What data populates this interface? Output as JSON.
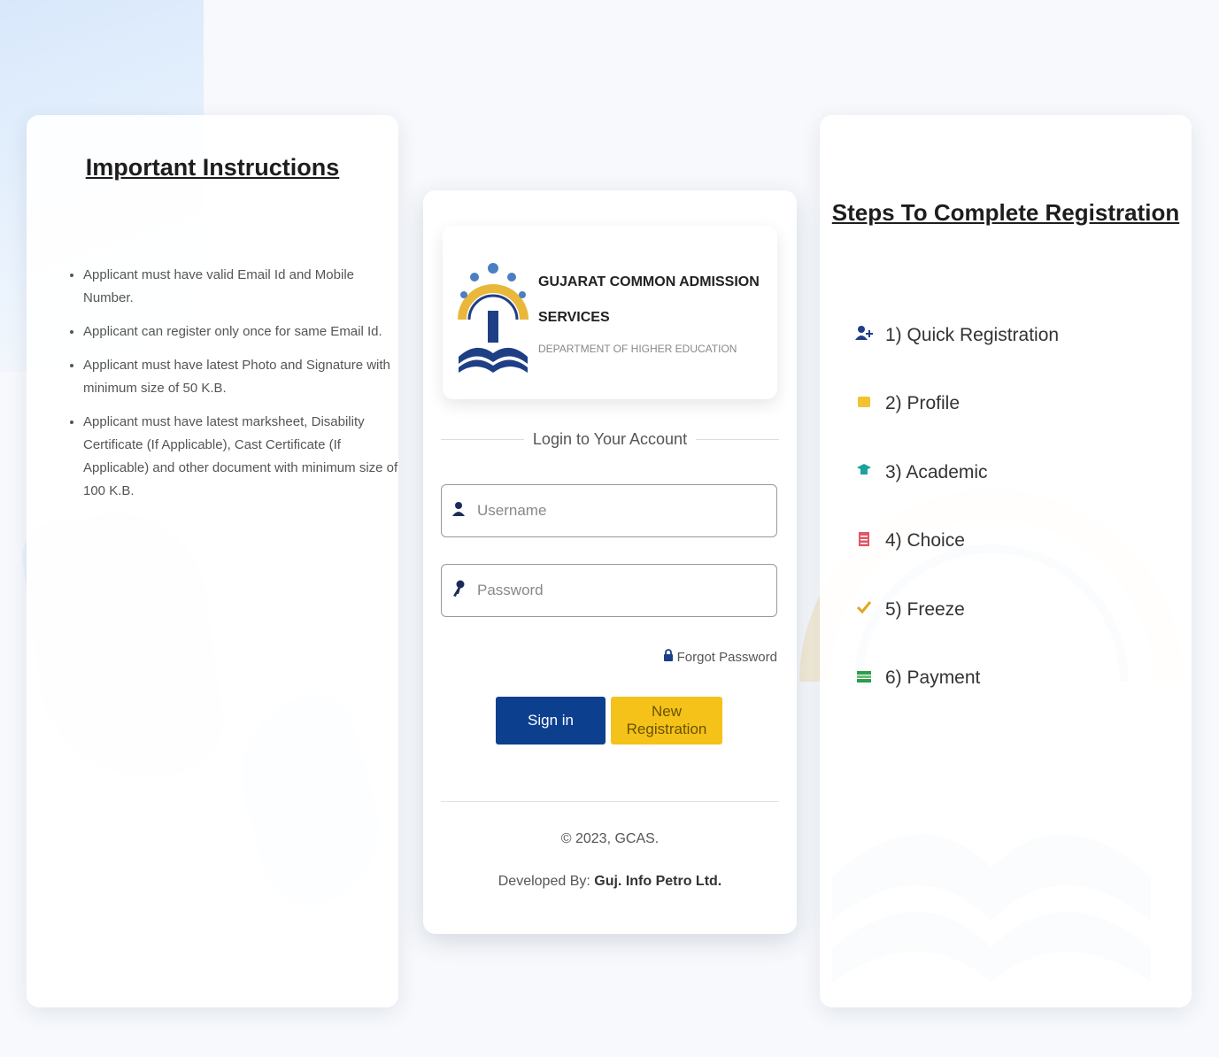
{
  "instructions": {
    "title": "Important Instructions",
    "items": [
      "Applicant must have valid Email Id and Mobile Number.",
      "Applicant can register only once for same Email Id.",
      "Applicant must have latest Photo and Signature with minimum size of 50 K.B.",
      "Applicant must have latest marksheet, Disability Certificate (If Applicable), Cast Certificate (If Applicable) and other document with minimum size of 100 K.B."
    ]
  },
  "brand": {
    "name": "GUJARAT COMMON ADMISSION SERVICES",
    "department": "DEPARTMENT OF HIGHER EDUCATION"
  },
  "login": {
    "heading": "Login to Your Account",
    "username_placeholder": "Username",
    "password_placeholder": "Password",
    "forgot_label": "Forgot Password",
    "signin_label": "Sign in",
    "register_label": "New Registration",
    "copyright": "© 2023, GCAS.",
    "developed_prefix": "Developed By: ",
    "developer": "Guj. Info Petro Ltd."
  },
  "steps": {
    "title": "Steps To Complete Registration",
    "items": [
      {
        "label": "1) Quick Registration",
        "icon": "user-plus-icon",
        "color": "#1e3f86"
      },
      {
        "label": "2) Profile",
        "icon": "profile-card-icon",
        "color": "#f2c230"
      },
      {
        "label": "3) Academic",
        "icon": "graduation-cap-icon",
        "color": "#1aa39a"
      },
      {
        "label": "4) Choice",
        "icon": "list-icon",
        "color": "#e0566a"
      },
      {
        "label": "5) Freeze",
        "icon": "check-icon",
        "color": "#e3a624"
      },
      {
        "label": "6) Payment",
        "icon": "money-icon",
        "color": "#2f9c4a"
      }
    ]
  }
}
